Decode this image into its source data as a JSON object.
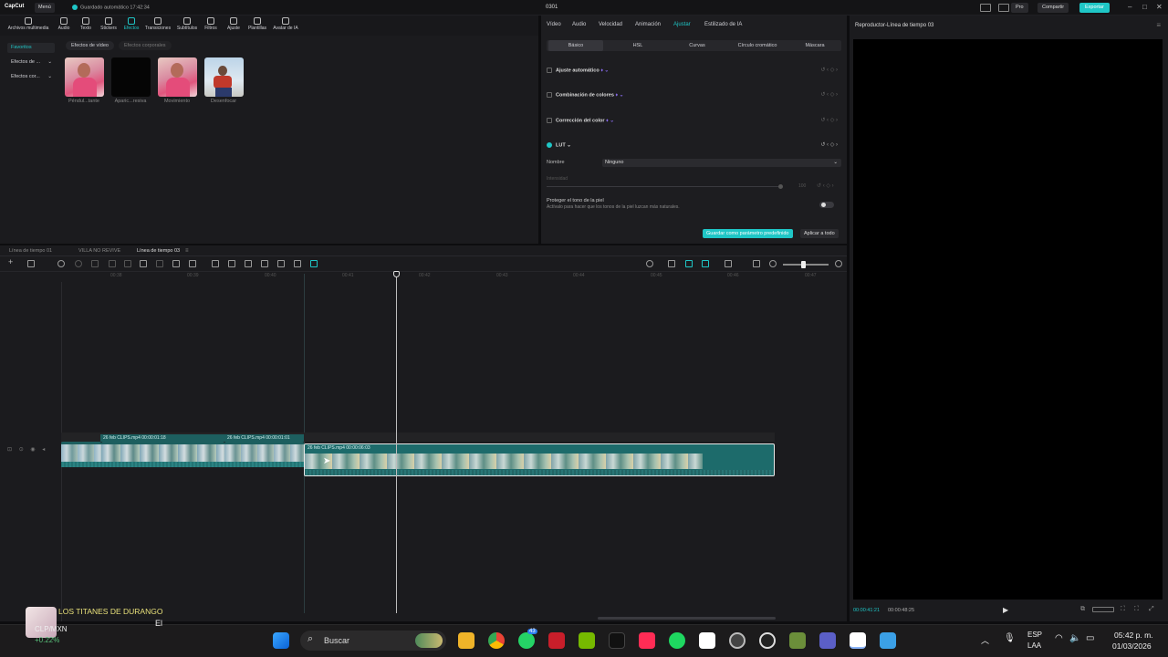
{
  "app": {
    "logo": "CapCut",
    "menu_label": "Menú",
    "autosave": "Guardado automático 17:42:34",
    "project_title": "0301",
    "pro_label": "Pro",
    "share_label": "Compartir",
    "export_label": "Exportar"
  },
  "media_toolbar": [
    {
      "label": "Archivos multimedia",
      "icon": "media-icon"
    },
    {
      "label": "Audio",
      "icon": "audio-icon"
    },
    {
      "label": "Texto",
      "icon": "text-icon"
    },
    {
      "label": "Stickers",
      "icon": "sticker-icon"
    },
    {
      "label": "Efectos",
      "icon": "effects-icon",
      "active": true
    },
    {
      "label": "Transiciones",
      "icon": "transition-icon"
    },
    {
      "label": "Subtítulos",
      "icon": "subtitle-icon"
    },
    {
      "label": "Filtros",
      "icon": "filter-icon"
    },
    {
      "label": "Ajuste",
      "icon": "adjust-icon"
    },
    {
      "label": "Plantillas",
      "icon": "template-icon"
    },
    {
      "label": "Avatar de IA",
      "icon": "ai-avatar-icon"
    }
  ],
  "sidebar": {
    "items": [
      {
        "label": "Favoritos",
        "active": true
      },
      {
        "label": "Efectos de ..."
      },
      {
        "label": "Efectos cor..."
      }
    ]
  },
  "effects_tabs": [
    "Efectos de vídeo",
    "Efectos corporales"
  ],
  "effects": [
    {
      "label": "Péndul...tante"
    },
    {
      "label": "Aparic...resiva"
    },
    {
      "label": "Movimiento"
    },
    {
      "label": "Desenfocar"
    }
  ],
  "adjust_panel": {
    "tabs": [
      "Vídeo",
      "Audio",
      "Velocidad",
      "Animación",
      "Ajustar",
      "Estilizado de IA"
    ],
    "active_tab": "Ajustar",
    "sub_tabs": [
      "Básico",
      "HSL",
      "Curvas",
      "Círculo cromático",
      "Máscara"
    ],
    "rows": [
      {
        "label": "Ajuste automático"
      },
      {
        "label": "Combinación de colores"
      },
      {
        "label": "Corrección del color"
      },
      {
        "label": "LUT"
      }
    ],
    "nombre_label": "Nombre",
    "nombre_value": "Ninguno",
    "intensidad_label": "Intensidad",
    "intensidad_value": "100",
    "skin_title": "Proteger el tono de la piel",
    "skin_desc": "Actívalo para hacer que los tonos de la piel luzcan más naturales.",
    "save_preset": "Guardar como parámetro predefinido",
    "apply_all": "Aplicar a todo"
  },
  "player": {
    "title": "Reproductor-Línea de tiempo 03",
    "current_time": "00:00:41:21",
    "total_time": "00:00:48:25"
  },
  "timeline": {
    "tabs": [
      "Línea de tiempo 01",
      "VILLA NO REVIVE",
      "Línea de tiempo 03"
    ],
    "active_tab": "Línea de tiempo 03",
    "ruler": [
      "00:38",
      "00:39",
      "00:40",
      "00:41",
      "00:42",
      "00:43",
      "00:44",
      "00:45",
      "00:46",
      "00:47"
    ],
    "clips": [
      {
        "label": "26 feb CLIPS.mp4  00:00:01:18"
      },
      {
        "label": "26 feb CLIPS.mp4  00:00:01:01"
      },
      {
        "label": "26 feb CLIPS.mp4  00:00:06:03"
      }
    ]
  },
  "taskbar": {
    "search_placeholder": "Buscar",
    "music_title": "LOS TITANES DE DURANGO",
    "music_extra": "El",
    "ticker": "CLP/MXN",
    "ticker_change": "+0.22%",
    "lang": "ESP",
    "lang_sub": "LAA",
    "time": "05:42 p. m.",
    "date": "01/03/2026",
    "whatsapp_badge": "43"
  }
}
